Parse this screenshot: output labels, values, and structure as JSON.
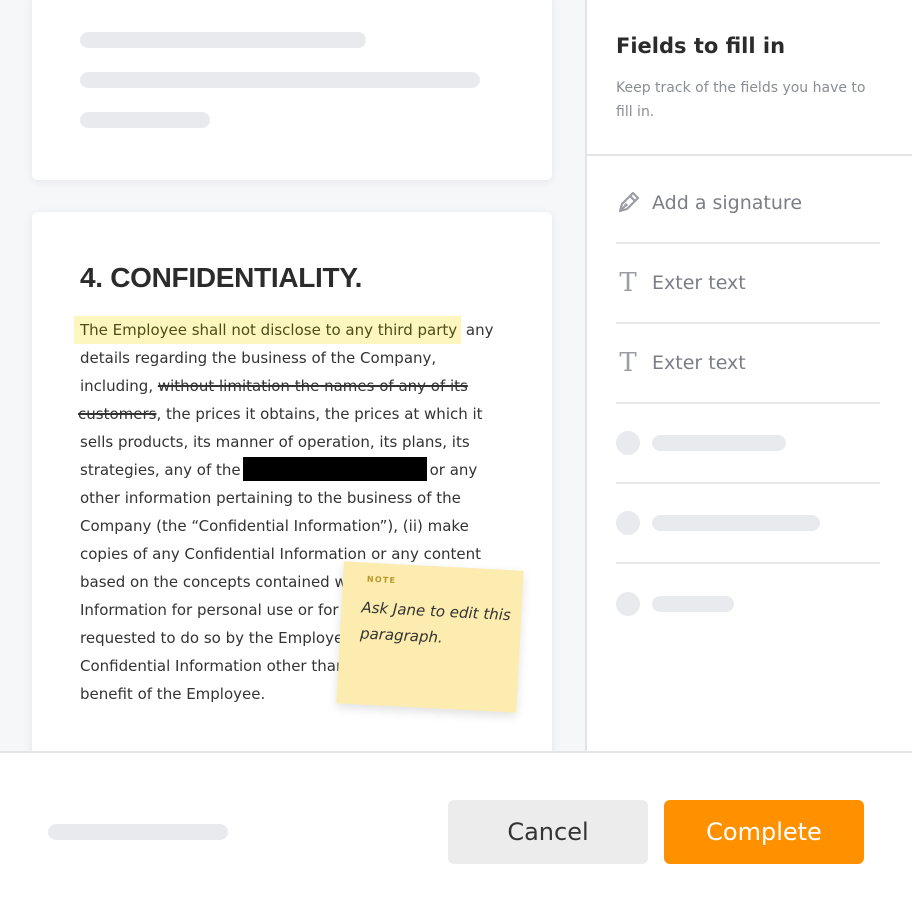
{
  "document": {
    "section_title": "4. CONFIDENTIALITY.",
    "paragraph": {
      "highlighted": "The Employee shall not disclose to any third party",
      "l1_tail": " any",
      "l2": "details regarding the business of the Company,",
      "l3_a": "including, ",
      "l3_strike": "without limitation the names of any of its",
      "l4_strike": "customers",
      "l4_b": ", the prices it obtains, the prices at which it",
      "l5": "sells products, its manner of operation, its plans, its",
      "l6_a": "strategies, any of the",
      "l6_b": "or any",
      "l7": "other information pertaining to the business of the",
      "l8": "Company (the “Confidential Information”), (ii) make",
      "l9": "copies of any Confidential Information or any content",
      "l10": "based on the concepts contained wit",
      "l11": "Information for personal use or for c",
      "l12": "requested to do so by the Employee",
      "l13": "Confidential Information other than",
      "l14": "benefit of the Employee."
    },
    "note": {
      "label": "NOTE",
      "text": "Ask Jane to edit this paragraph."
    }
  },
  "panel": {
    "title": "Fields to fill in",
    "description": "Keep track of the fields you have to fill in.",
    "fields": [
      {
        "icon": "pen-icon",
        "label": "Add a signature"
      },
      {
        "icon": "text-icon",
        "label": "Exter text"
      },
      {
        "icon": "text-icon",
        "label": "Exter text"
      }
    ]
  },
  "footer": {
    "cancel_label": "Cancel",
    "complete_label": "Complete"
  },
  "colors": {
    "accent": "#ff9100",
    "highlight": "#fdf7bf",
    "note": "#fdecaf"
  }
}
